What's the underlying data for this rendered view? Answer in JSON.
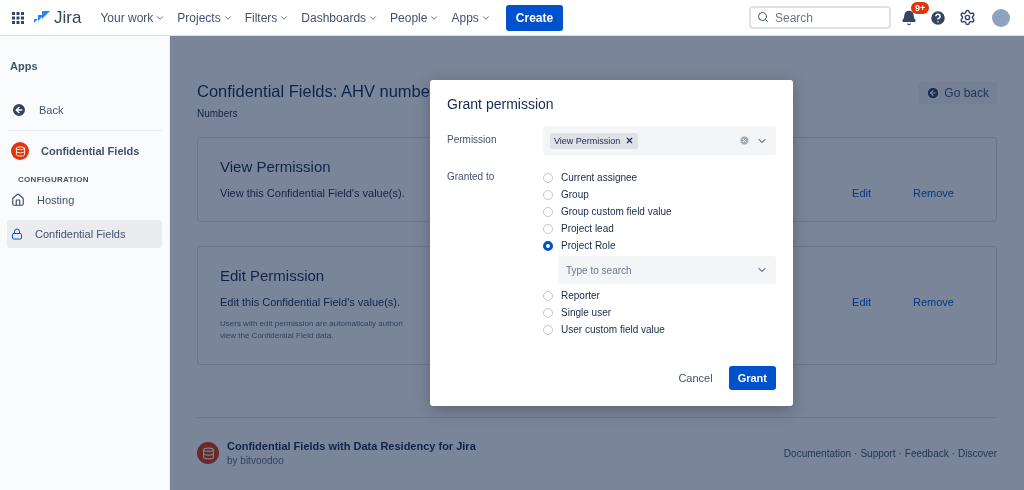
{
  "topbar": {
    "logo": "Jira",
    "nav": [
      {
        "label": "Your work"
      },
      {
        "label": "Projects"
      },
      {
        "label": "Filters"
      },
      {
        "label": "Dashboards"
      },
      {
        "label": "People"
      },
      {
        "label": "Apps"
      }
    ],
    "create": "Create",
    "search": {
      "placeholder": "Search"
    },
    "notification_badge": "9+"
  },
  "sidebar": {
    "heading": "Apps",
    "items": [
      {
        "kind": "back",
        "label": "Back",
        "selected": false
      },
      {
        "kind": "app",
        "label": "Confidential Fields",
        "selected": false
      },
      {
        "kind": "section",
        "label": "CONFIGURATION"
      },
      {
        "kind": "hosting",
        "label": "Hosting",
        "selected": false
      },
      {
        "kind": "lock",
        "label": "Confidential Fields",
        "selected": true
      }
    ]
  },
  "page": {
    "title": "Confidential Fields: AHV numbe",
    "subtitle": "Numbers",
    "go_back": "Go back",
    "cards": [
      {
        "title": "View Permission",
        "description": "View this Confidential Field's value(s).",
        "actions": [
          "Edit",
          "Remove"
        ]
      },
      {
        "title": "Edit Permission",
        "description": "Edit this Confidential Field's value(s).",
        "note": "Users with edit permission are automatically authori\nview the Confidential Field data.",
        "actions": [
          "Edit",
          "Remove"
        ]
      }
    ],
    "footer": {
      "app_name": "Confidential Fields with Data Residency for Jira",
      "vendor": "by bitvoodoo",
      "separator": "·",
      "links": [
        "Documentation",
        "Support",
        "Feedback",
        "Discover"
      ]
    }
  },
  "dialog": {
    "title": "Grant permission",
    "permission_label": "Permission",
    "permission_tag": "View Permission",
    "granted_label": "Granted to",
    "options": [
      {
        "label": "Current assignee",
        "selected": false
      },
      {
        "label": "Group",
        "selected": false
      },
      {
        "label": "Group custom field value",
        "selected": false
      },
      {
        "label": "Project lead",
        "selected": false
      },
      {
        "label": "Project Role",
        "selected": true,
        "sub_field": {
          "placeholder": "Type to search"
        }
      },
      {
        "label": "Reporter",
        "selected": false
      },
      {
        "label": "Single user",
        "selected": false
      },
      {
        "label": "User custom field value",
        "selected": false
      }
    ],
    "cancel": "Cancel",
    "grant": "Grant"
  }
}
